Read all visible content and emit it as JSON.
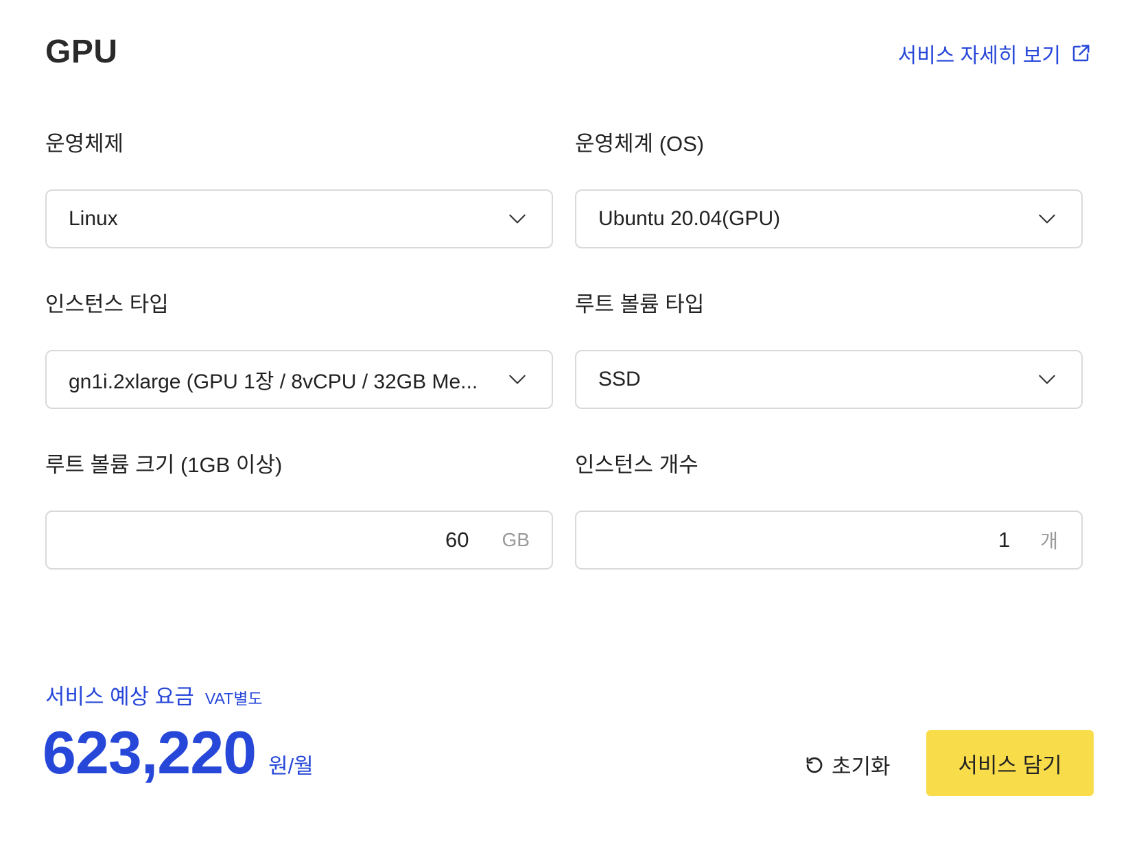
{
  "header": {
    "title": "GPU",
    "detail_link_label": "서비스 자세히 보기"
  },
  "form": {
    "os_category": {
      "label": "운영체제",
      "value": "Linux"
    },
    "os": {
      "label": "운영체계 (OS)",
      "value": "Ubuntu 20.04(GPU)"
    },
    "instance_type": {
      "label": "인스턴스 타입",
      "value": "gn1i.2xlarge (GPU 1장 / 8vCPU / 32GB Me..."
    },
    "root_volume_type": {
      "label": "루트 볼륨 타입",
      "value": "SSD"
    },
    "root_volume_size": {
      "label": "루트 볼륨 크기 (1GB 이상)",
      "value": "60",
      "unit": "GB"
    },
    "instance_count": {
      "label": "인스턴스 개수",
      "value": "1",
      "unit": "개"
    }
  },
  "pricing": {
    "label": "서비스 예상 요금",
    "vat_note": "VAT별도",
    "amount": "623,220",
    "per": "원/월"
  },
  "actions": {
    "reset_label": "초기화",
    "add_to_cart_label": "서비스 담기"
  },
  "colors": {
    "accent": "#2747d9",
    "primary_button": "#f9dc4a",
    "border": "#d9d9d9"
  },
  "icons": {
    "external_link": "external-link-icon",
    "dropdown": "chevron-down-icon",
    "reset": "reset-icon"
  }
}
